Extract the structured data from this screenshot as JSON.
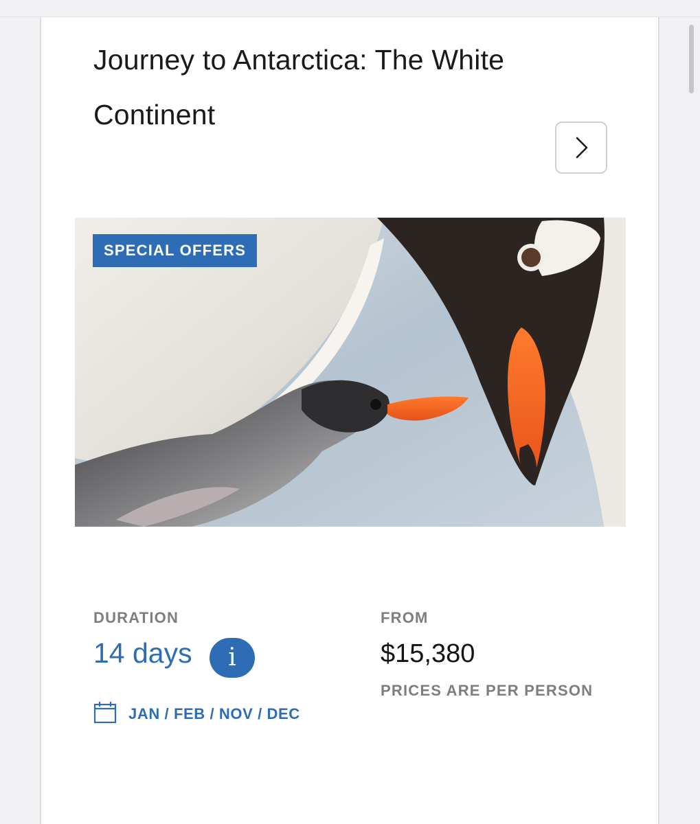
{
  "trip": {
    "title": "Journey to Antarctica: The White Continent",
    "next_icon": "chevron-right-icon"
  },
  "image": {
    "badge": "SPECIAL OFFERS",
    "subject": "gentoo penguin adult feeding chick"
  },
  "details": {
    "duration_label": "DURATION",
    "duration_value": "14 days",
    "info_symbol": "i",
    "months": "JAN / FEB / NOV / DEC",
    "calendar_icon": "calendar-icon",
    "price_label": "FROM",
    "price_value": "$15,380",
    "price_note": "PRICES ARE PER PERSON"
  },
  "colors": {
    "accent": "#2e6db5",
    "label_gray": "#7d7d82",
    "text": "#141414"
  }
}
